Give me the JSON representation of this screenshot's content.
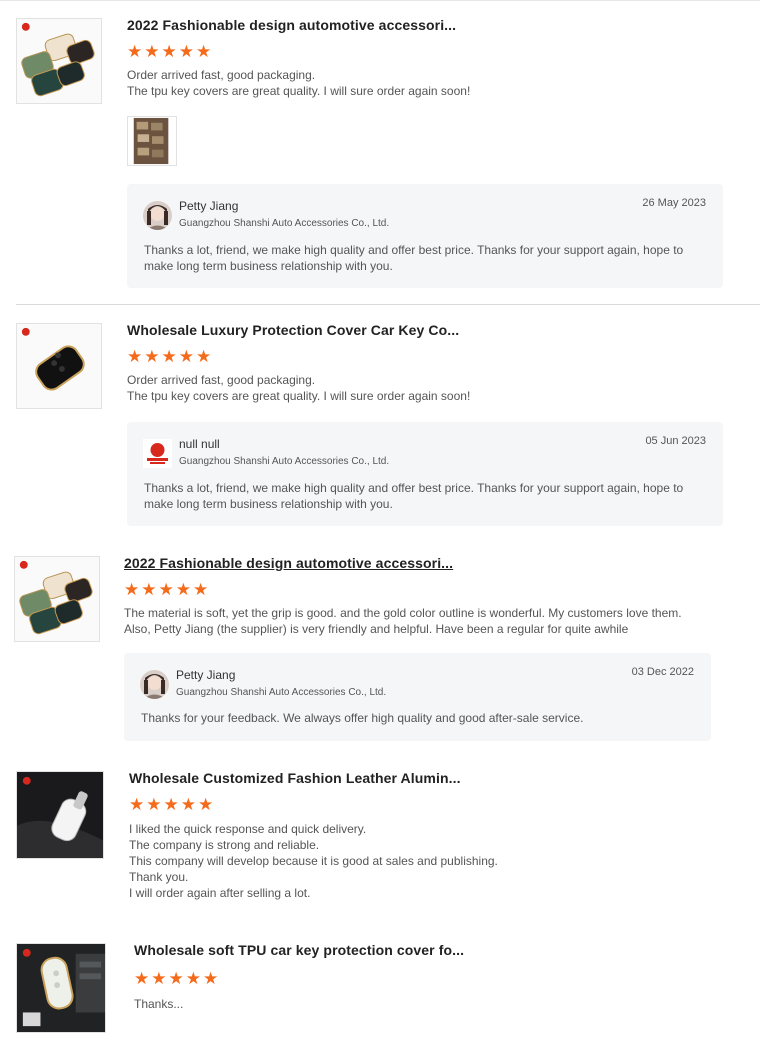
{
  "reviews": [
    {
      "title": "2022 Fashionable design automotive accessori...",
      "rating": 5,
      "lines": [
        "Order arrived fast, good packaging.",
        "The tpu key covers are great quality. I will sure order again soon!"
      ],
      "reply": {
        "name": "Petty Jiang",
        "company": "Guangzhou Shanshi Auto Accessories Co., Ltd.",
        "date": "26 May 2023",
        "text": "Thanks a lot, friend, we make high quality and offer best price. Thanks for your support again, hope to make long term business relationship with you."
      }
    },
    {
      "title": "Wholesale Luxury Protection Cover Car Key Co...",
      "rating": 5,
      "lines": [
        "Order arrived fast, good packaging.",
        "The tpu key covers are great quality. I will sure order again soon!"
      ],
      "reply": {
        "name": "null null",
        "company": "Guangzhou Shanshi Auto Accessories Co., Ltd.",
        "date": "05 Jun 2023",
        "text": "Thanks a lot, friend, we make high quality and offer best price. Thanks for your support again, hope to make long term business relationship with you."
      }
    },
    {
      "title": "2022 Fashionable design automotive accessori...",
      "rating": 5,
      "lines": [
        "The material is soft, yet the grip is good. and the gold color outline is wonderful. My customers love them.",
        "Also, Petty Jiang (the supplier) is very friendly and helpful. Have been a regular for quite awhile"
      ],
      "reply": {
        "name": "Petty Jiang",
        "company": "Guangzhou Shanshi Auto Accessories Co., Ltd.",
        "date": "03 Dec 2022",
        "text": "Thanks for your feedback. We always offer high quality and good after-sale service."
      }
    },
    {
      "title": "Wholesale Customized Fashion Leather Alumin...",
      "rating": 5,
      "lines": [
        "I liked the quick response and quick delivery.",
        "The company is strong and reliable.",
        "This company will develop because it is good at sales and publishing.",
        "Thank you.",
        "I will order again after selling a lot."
      ]
    },
    {
      "title": "Wholesale soft TPU car key protection cover fo...",
      "rating": 5,
      "lines": [
        "Thanks..."
      ]
    }
  ],
  "star_glyph": "★",
  "star_color": "#f56b1c",
  "icons": {
    "brand_logo": "red-logo-icon",
    "avatar_photo": "avatar-icon"
  }
}
